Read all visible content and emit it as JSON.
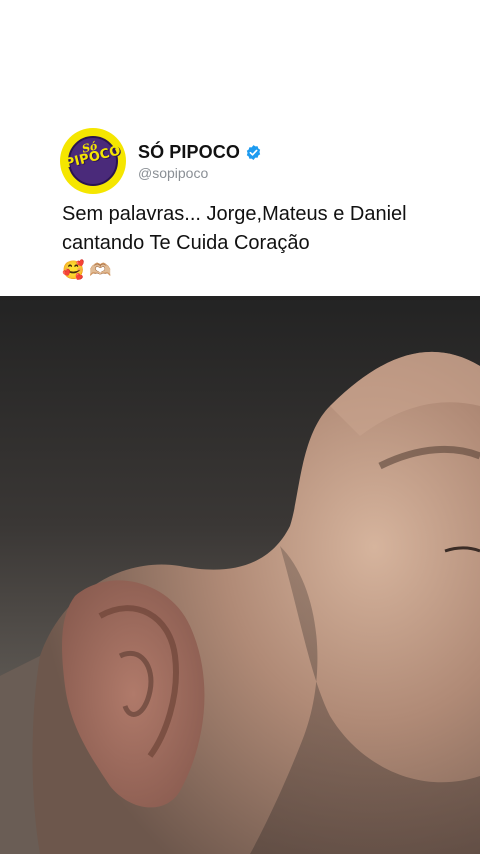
{
  "post": {
    "account_name": "SÓ PIPOCO",
    "handle": "@sopipoco",
    "text": "Sem palavras... Jorge,Mateus e Daniel cantando Te Cuida Coração",
    "emojis": "🥰 🫶🏼",
    "avatar": {
      "logo_top": "Só",
      "logo_main": "PIPOCO"
    },
    "verified": true
  },
  "colors": {
    "accent_blue": "#1d9bf0",
    "logo_yellow": "#f5e600",
    "logo_purple": "#4a2a7a"
  },
  "icons": [
    "verified-badge-icon"
  ]
}
